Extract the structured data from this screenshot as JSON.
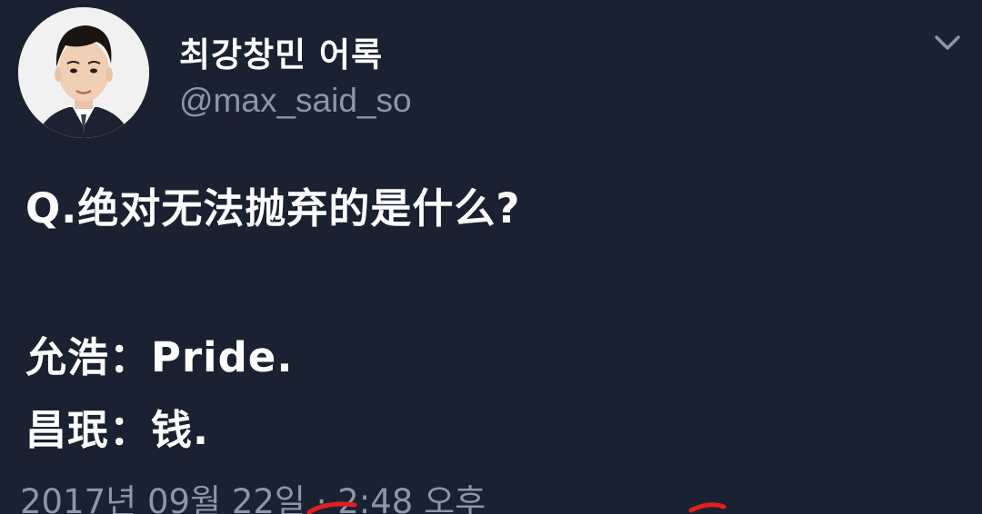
{
  "tweet": {
    "display_name": "최강창민 어록",
    "handle": "@max_said_so",
    "question": "Q.绝对无法抛弃的是什么?",
    "answer_1": "允浩：Pride.",
    "answer_2": "昌珉：钱.",
    "timestamp": "2017년 09월 22일 · 2:48 오후"
  },
  "icons": {
    "menu": "chevron-down-icon",
    "avatar": "profile-photo"
  },
  "colors": {
    "background": "#1a2130",
    "primary_text": "#ffffff",
    "secondary_text": "#8b97a6",
    "annotation": "#e02020"
  }
}
